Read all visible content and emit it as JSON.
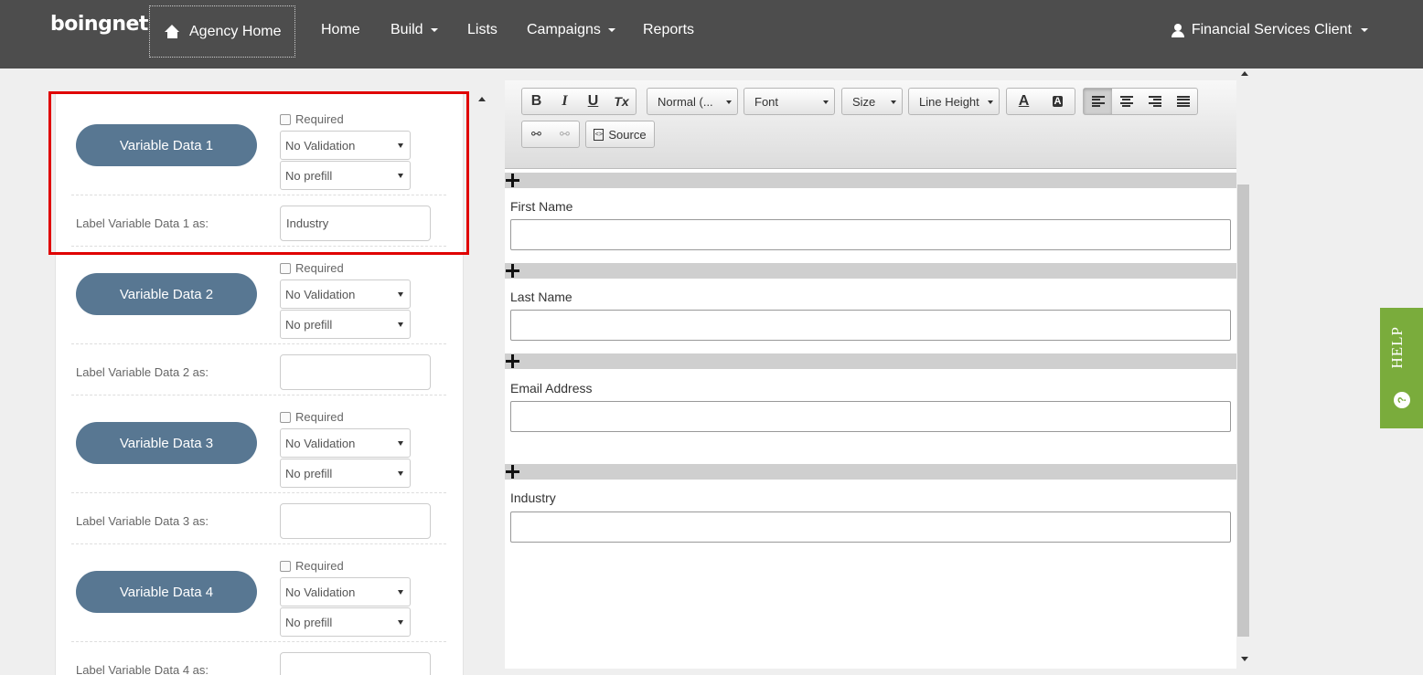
{
  "nav": {
    "logo": "boingnet",
    "agency_home": "Agency Home",
    "items": [
      "Home",
      "Build",
      "Lists",
      "Campaigns",
      "Reports"
    ],
    "user": "Financial Services Client"
  },
  "variables": [
    {
      "button": "Variable Data 1",
      "required": "Required",
      "validation": "No Validation",
      "prefill": "No prefill",
      "label": "Label Variable Data 1 as:",
      "value": "Industry"
    },
    {
      "button": "Variable Data 2",
      "required": "Required",
      "validation": "No Validation",
      "prefill": "No prefill",
      "label": "Label Variable Data 2 as:",
      "value": ""
    },
    {
      "button": "Variable Data 3",
      "required": "Required",
      "validation": "No Validation",
      "prefill": "No prefill",
      "label": "Label Variable Data 3 as:",
      "value": ""
    },
    {
      "button": "Variable Data 4",
      "required": "Required",
      "validation": "No Validation",
      "prefill": "No prefill",
      "label": "Label Variable Data 4 as:",
      "value": ""
    }
  ],
  "toolbar": {
    "bold": "B",
    "italic": "I",
    "underline": "U",
    "clear_format": "Tx",
    "format": "Normal (...",
    "font": "Font",
    "size": "Size",
    "line_height": "Line Height",
    "text_color": "A",
    "bg_color": "A",
    "source": "Source"
  },
  "form_fields": [
    {
      "label": "First Name"
    },
    {
      "label": "Last Name"
    },
    {
      "label": "Email Address"
    },
    {
      "label": "Industry"
    }
  ],
  "help": {
    "label": "HELP",
    "icon": "?"
  },
  "colors": {
    "nav_bg": "#4d4d4d",
    "pill": "#587792",
    "highlight": "#e00000",
    "help": "#7aac3c"
  }
}
